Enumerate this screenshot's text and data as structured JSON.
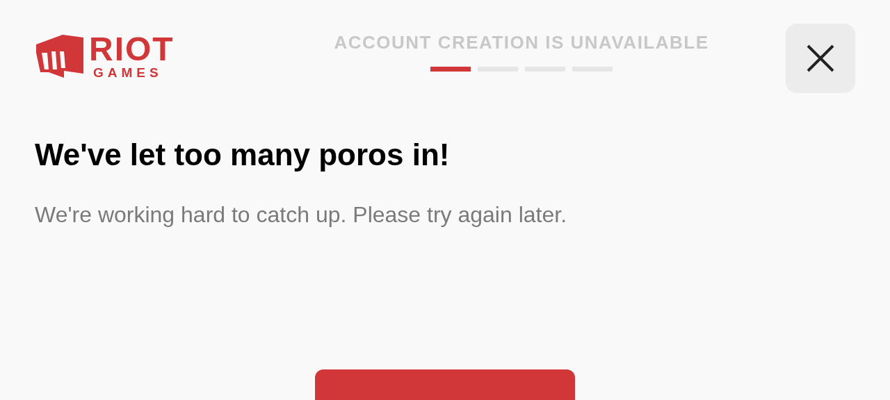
{
  "logo": {
    "line_1": "RIOT",
    "line_2": "GAMES"
  },
  "header": {
    "title": "ACCOUNT CREATION IS UNAVAILABLE"
  },
  "steps": [
    {
      "done": true
    },
    {
      "done": false
    },
    {
      "done": false
    },
    {
      "done": false
    }
  ],
  "heading": "We've let too many poros in!",
  "message": "We're working hard to catch up. Please try again later."
}
